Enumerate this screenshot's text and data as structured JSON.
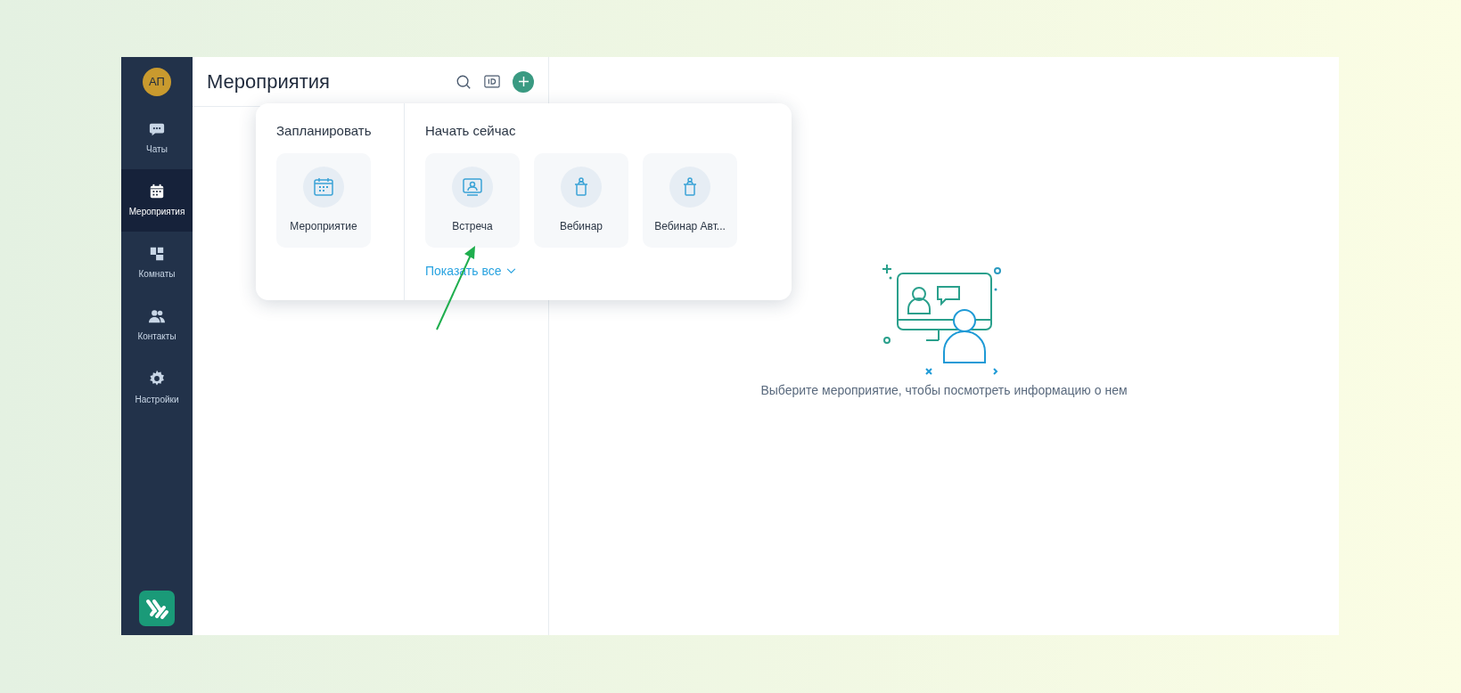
{
  "sidebar": {
    "avatar": "АП",
    "items": [
      {
        "label": "Чаты",
        "selected": false
      },
      {
        "label": "Мероприятия",
        "selected": true
      },
      {
        "label": "Комнаты",
        "selected": false
      },
      {
        "label": "Контакты",
        "selected": false
      },
      {
        "label": "Настройки",
        "selected": false
      }
    ]
  },
  "list_panel": {
    "title": "Мероприятия"
  },
  "popup": {
    "sections": [
      {
        "title": "Запланировать",
        "options": [
          {
            "kind": "calendar",
            "label": "Мероприятие"
          }
        ]
      },
      {
        "title": "Начать сейчас",
        "options": [
          {
            "kind": "meeting",
            "label": "Встреча"
          },
          {
            "kind": "webinar",
            "label": "Вебинар"
          },
          {
            "kind": "webinar",
            "label": "Вебинар Авт..."
          }
        ],
        "show_all": "Показать все"
      }
    ]
  },
  "empty_state": {
    "message": "Выберите мероприятие, чтобы посмотреть информацию о нем"
  }
}
